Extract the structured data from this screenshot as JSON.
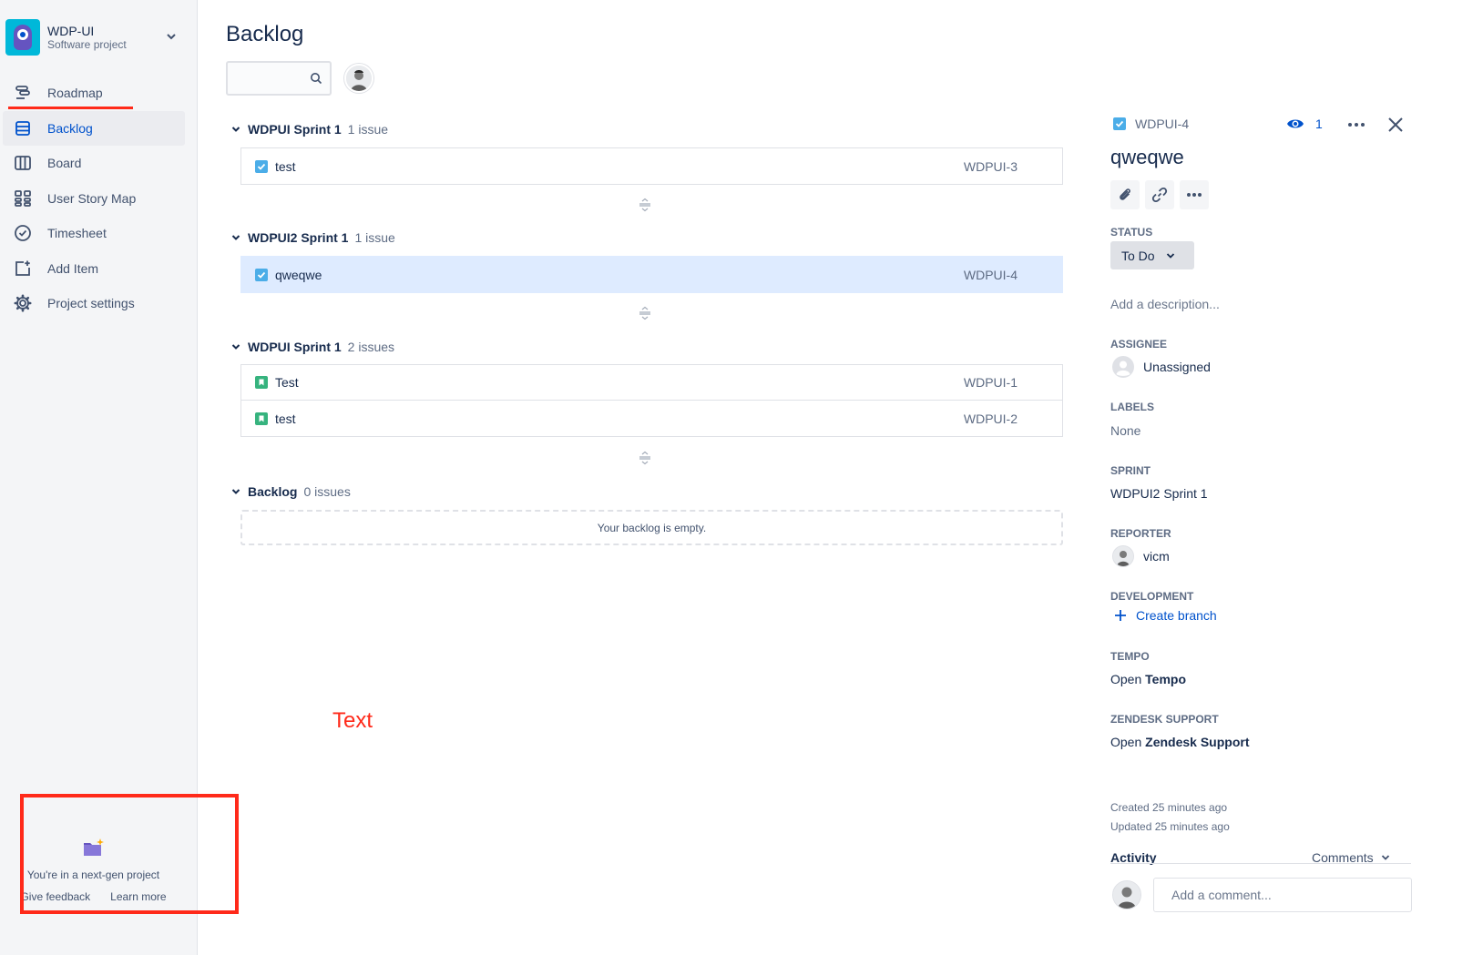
{
  "project": {
    "name": "WDP-UI",
    "type": "Software project"
  },
  "sidebar": {
    "items": [
      {
        "label": "Roadmap",
        "icon": "roadmap-icon"
      },
      {
        "label": "Backlog",
        "icon": "backlog-icon",
        "active": true
      },
      {
        "label": "Board",
        "icon": "board-icon"
      },
      {
        "label": "User Story Map",
        "icon": "story-map-icon"
      },
      {
        "label": "Timesheet",
        "icon": "timesheet-icon"
      },
      {
        "label": "Add Item",
        "icon": "add-item-icon"
      },
      {
        "label": "Project settings",
        "icon": "gear-icon"
      }
    ],
    "nextgen": {
      "message": "You're in a next-gen project",
      "feedback": "Give feedback",
      "learn_more": "Learn more"
    }
  },
  "main": {
    "title": "Backlog",
    "search_placeholder": "",
    "sprints": [
      {
        "name": "WDPUI Sprint 1",
        "count": "1 issue",
        "issues": [
          {
            "summary": "test",
            "key": "WDPUI-3",
            "type": "task"
          }
        ]
      },
      {
        "name": "WDPUI2 Sprint 1",
        "count": "1 issue",
        "issues": [
          {
            "summary": "qweqwe",
            "key": "WDPUI-4",
            "type": "task",
            "selected": true
          }
        ]
      },
      {
        "name": "WDPUI Sprint 1",
        "count": "2 issues",
        "issues": [
          {
            "summary": "Test",
            "key": "WDPUI-1",
            "type": "story"
          },
          {
            "summary": "test",
            "key": "WDPUI-2",
            "type": "story"
          }
        ]
      }
    ],
    "backlog": {
      "name": "Backlog",
      "count": "0 issues",
      "empty_text": "Your backlog is empty."
    },
    "annotation_text": "Text"
  },
  "detail": {
    "key": "WDPUI-4",
    "watch_count": "1",
    "title": "qweqwe",
    "status_label": "STATUS",
    "status": "To Do",
    "description_placeholder": "Add a description...",
    "assignee_label": "ASSIGNEE",
    "assignee": "Unassigned",
    "labels_label": "LABELS",
    "labels": "None",
    "sprint_label": "SPRINT",
    "sprint": "WDPUI2 Sprint 1",
    "reporter_label": "REPORTER",
    "reporter": "vicm",
    "development_label": "DEVELOPMENT",
    "create_branch": "Create branch",
    "tempo_label": "TEMPO",
    "tempo_open": "Open",
    "tempo_name": "Tempo",
    "zendesk_label": "ZENDESK SUPPORT",
    "zendesk_open": "Open",
    "zendesk_name": "Zendesk Support",
    "created": "Created 25 minutes ago",
    "updated": "Updated 25 minutes ago",
    "activity": "Activity",
    "comments_filter": "Comments",
    "comment_placeholder": "Add a comment..."
  },
  "colors": {
    "accent": "#0052cc",
    "annotation": "#ff2a1a",
    "selected_row": "#deebff",
    "story": "#36b37e",
    "task": "#4bade8"
  }
}
